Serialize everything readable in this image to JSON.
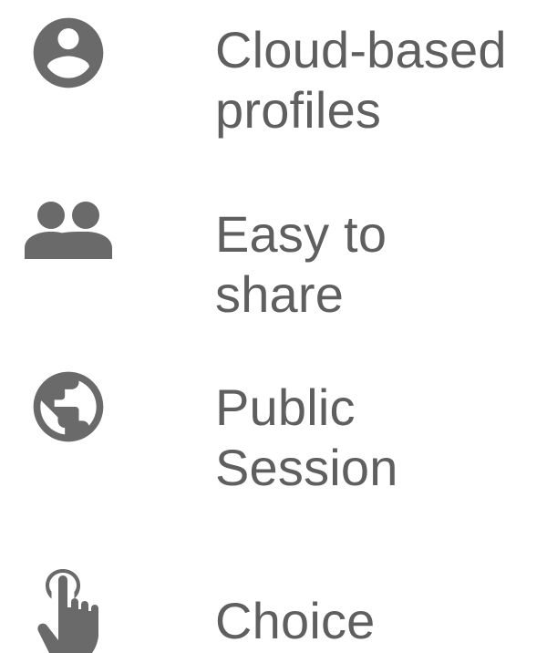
{
  "features": [
    {
      "icon": "account-circle-icon",
      "line1": "Cloud-based",
      "line2": "profiles"
    },
    {
      "icon": "people-icon",
      "line1": "Easy to",
      "line2": "share"
    },
    {
      "icon": "globe-icon",
      "line1": "Public",
      "line2": "Session"
    },
    {
      "icon": "touch-hand-icon",
      "line1": "Choice",
      "line2": ""
    }
  ],
  "colors": {
    "icon": "#6a6a6a",
    "text": "#5f5f5f",
    "background": "#ffffff"
  }
}
